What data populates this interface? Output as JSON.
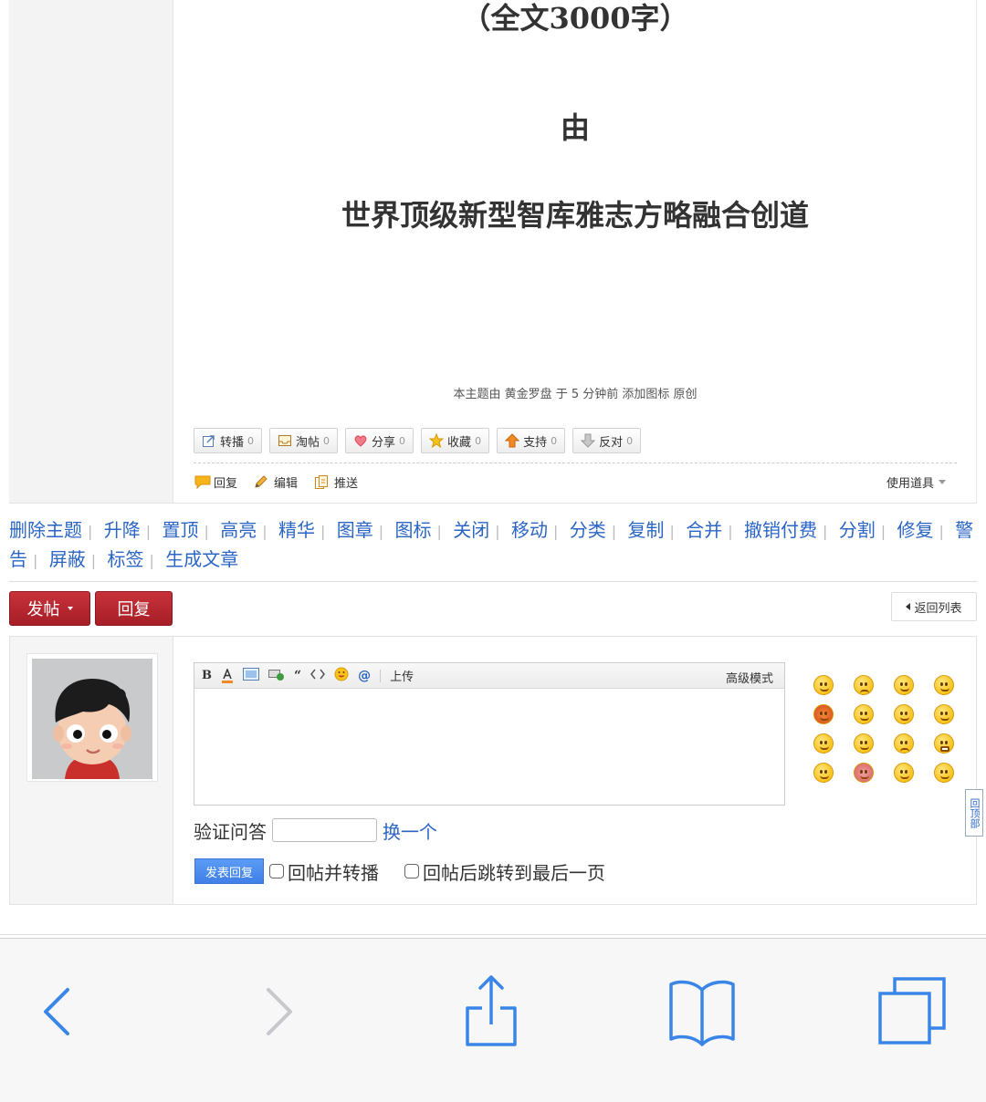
{
  "post": {
    "subtitle": "（全文3000字）",
    "by": "由",
    "author_title": "世界顶级新型智库雅志方略融合创道",
    "notice": "本主题由 黄金罗盘 于 5 分钟前 添加图标 原创",
    "actions": [
      {
        "icon": "forward-icon",
        "label": "转播",
        "count": "0"
      },
      {
        "icon": "tray-icon",
        "label": "淘帖",
        "count": "0"
      },
      {
        "icon": "heart-icon",
        "label": "分享",
        "count": "0"
      },
      {
        "icon": "star-icon",
        "label": "收藏",
        "count": "0"
      },
      {
        "icon": "up-arrow-icon",
        "label": "支持",
        "count": "0"
      },
      {
        "icon": "down-arrow-icon",
        "label": "反对",
        "count": "0"
      }
    ],
    "tools": [
      {
        "icon": "reply-bubble-icon",
        "label": "回复"
      },
      {
        "icon": "pencil-icon",
        "label": "编辑"
      },
      {
        "icon": "push-icon",
        "label": "推送"
      }
    ],
    "use_tools": "使用道具"
  },
  "moderation": [
    "删除主题",
    "升降",
    "置顶",
    "高亮",
    "精华",
    "图章",
    "图标",
    "关闭",
    "移动",
    "分类",
    "复制",
    "合并",
    "撤销付费",
    "分割",
    "修复",
    "警告",
    "屏蔽",
    "标签",
    "生成文章"
  ],
  "buttons": {
    "new_post": "发帖",
    "reply": "回复",
    "back_to_list": "返回列表"
  },
  "editor": {
    "toolbar_icons": [
      "bold-icon",
      "font-color-icon",
      "image-icon",
      "link-icon",
      "quote-icon",
      "code-icon",
      "smiley-icon",
      "at-icon"
    ],
    "bold": "B",
    "upload": "上传",
    "advanced": "高级模式"
  },
  "verify": {
    "label": "验证问答",
    "change": "换一个"
  },
  "submit": {
    "button": "发表回复",
    "opt1": "回帖并转播",
    "opt2": "回帖后跳转到最后一页"
  },
  "back_top": "回顶部",
  "smilies_count": 16,
  "colors": {
    "link": "#2b66c4",
    "red_button": "#b5252e",
    "submit_button": "#4a8bf0",
    "safari_blue": "#3a86e8"
  },
  "browser": {
    "icons": [
      "back-icon",
      "forward-icon",
      "share-icon",
      "bookmarks-icon",
      "tabs-icon"
    ]
  }
}
